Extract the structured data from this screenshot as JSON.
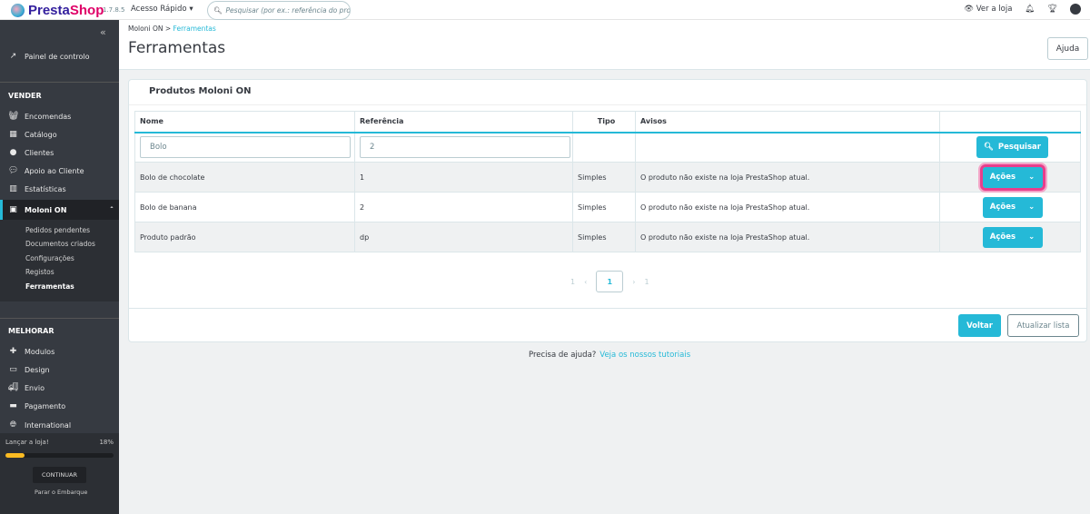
{
  "header": {
    "brand_prefix": "Presta",
    "brand_suffix": "Shop",
    "version": "1.7.8.5",
    "quick_access": "Acesso Rápido",
    "search_placeholder": "Pesquisar (por ex.: referência do produ",
    "view_store": "Ver a loja"
  },
  "sidebar": {
    "dashboard": "Painel de controlo",
    "section_sell": "VENDER",
    "sell_items": [
      "Encomendas",
      "Catálogo",
      "Clientes",
      "Apoio ao Cliente",
      "Estatísticas"
    ],
    "active": "Moloni ON",
    "sub_items": [
      "Pedidos pendentes",
      "Documentos criados",
      "Configurações",
      "Registos",
      "Ferramentas"
    ],
    "section_improve": "MELHORAR",
    "improve_items": [
      "Modulos",
      "Design",
      "Envio",
      "Pagamento",
      "International"
    ],
    "launch_label": "Lançar a loja!",
    "launch_percent": "18%",
    "launch_progress": 0.18,
    "continue": "CONTINUAR",
    "stop": "Parar o Embarque"
  },
  "breadcrumb": {
    "parent": "Moloni ON",
    "separator": ">",
    "current": "Ferramentas"
  },
  "page": {
    "title": "Ferramentas",
    "help": "Ajuda"
  },
  "panel": {
    "title": "Produtos Moloni ON",
    "columns": [
      "Nome",
      "Referência",
      "Tipo",
      "Avisos"
    ],
    "filters": {
      "name": "Bolo",
      "reference": "2"
    },
    "search_button": "Pesquisar",
    "rows": [
      {
        "name": "Bolo de chocolate",
        "reference": "1",
        "type": "Simples",
        "warning": "O produto não existe na loja PrestaShop atual.",
        "action": "Ações"
      },
      {
        "name": "Bolo de banana",
        "reference": "2",
        "type": "",
        "warning": "O produto não existe na loja PrestaShop atual.",
        "action": "Ações"
      },
      {
        "name": "Produto padrão",
        "reference": "dp",
        "type": "Simples",
        "warning": "O produto não existe na loja PrestaShop atual.",
        "action": "Ações"
      }
    ],
    "pagination": {
      "first": "1",
      "current": "1",
      "last": "1"
    },
    "back": "Voltar",
    "refresh": "Atualizar lista"
  },
  "footer": {
    "question": "Precisa de ajuda?",
    "link": "Veja os nossos tutoriais"
  },
  "colors": {
    "accent": "#25b9d7",
    "sidebar": "#363a41",
    "highlight": "#e83e8c",
    "progress": "#fbbb22"
  }
}
